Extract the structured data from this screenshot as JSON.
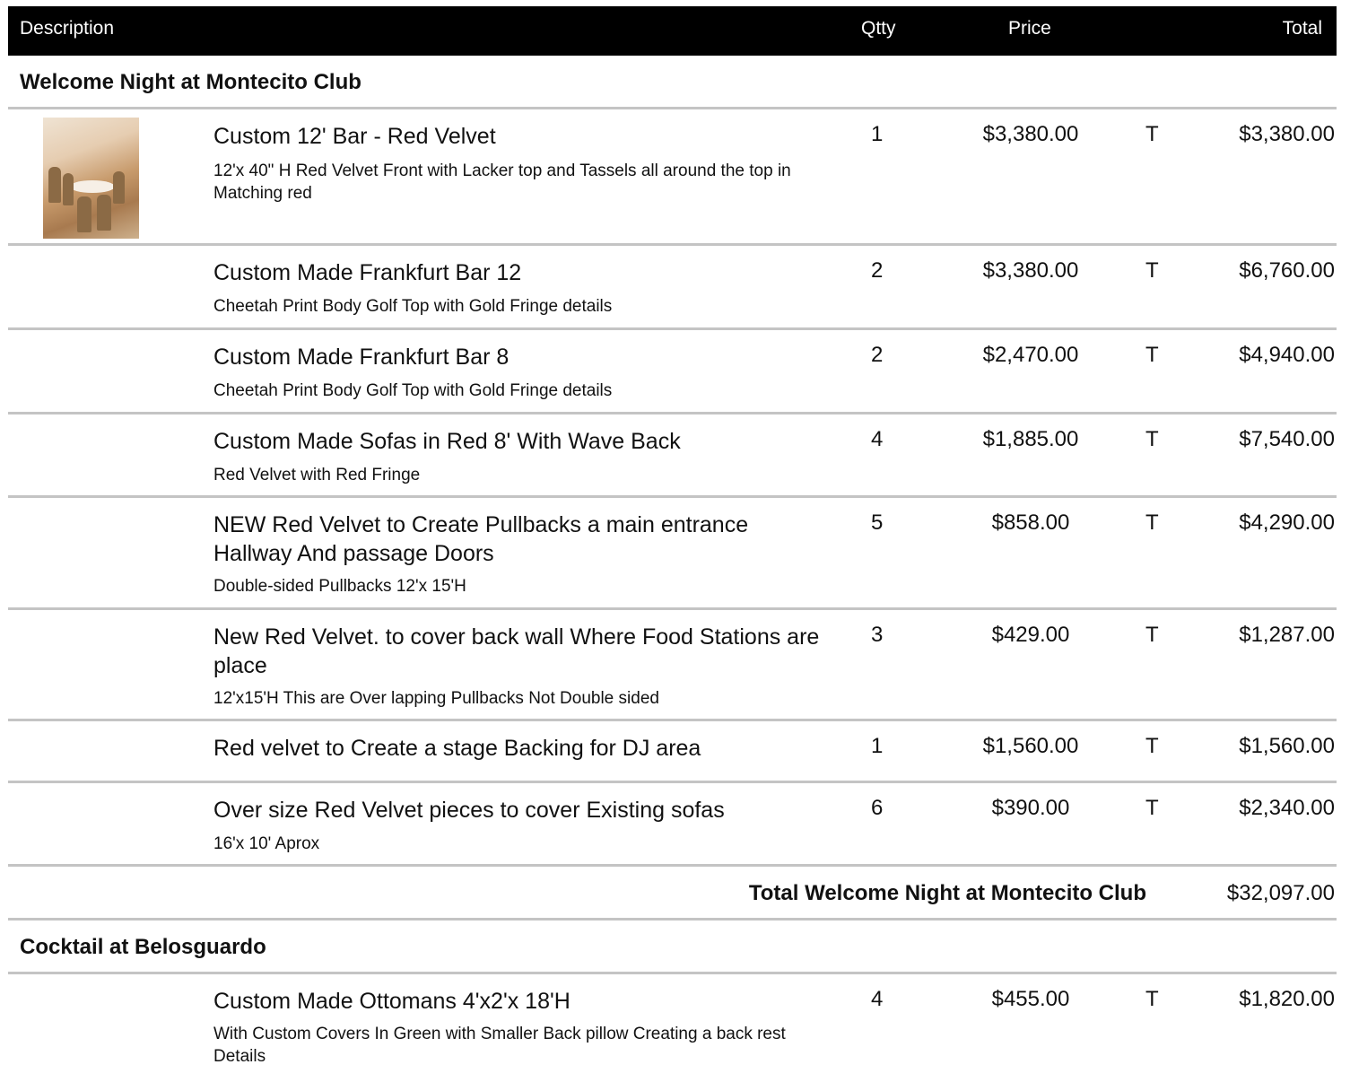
{
  "header": {
    "description": "Description",
    "qtty": "Qtty",
    "price": "Price",
    "total": "Total"
  },
  "sections": [
    {
      "title": "Welcome Night at Montecito Club",
      "items": [
        {
          "name": "Custom 12' Bar - Red Velvet",
          "desc": "12'x 40\" H Red Velvet Front with Lacker top and Tassels all around the top in Matching red",
          "qty": "1",
          "price": "$3,380.00",
          "tax": "T",
          "total": "$3,380.00"
        },
        {
          "name": "Custom Made Frankfurt Bar 12",
          "desc": "Cheetah Print Body   Golf Top with Gold Fringe details",
          "qty": "2",
          "price": "$3,380.00",
          "tax": "T",
          "total": "$6,760.00"
        },
        {
          "name": "Custom Made Frankfurt Bar 8",
          "desc": "Cheetah Print Body   Golf Top with Gold Fringe details",
          "qty": "2",
          "price": "$2,470.00",
          "tax": "T",
          "total": "$4,940.00"
        },
        {
          "name": "Custom Made Sofas in Red 8' With Wave Back",
          "desc": "Red Velvet with Red Fringe",
          "qty": "4",
          "price": "$1,885.00",
          "tax": "T",
          "total": "$7,540.00"
        },
        {
          "name": "NEW Red Velvet to Create Pullbacks a main entrance Hallway And passage Doors",
          "desc": "Double-sided Pullbacks 12'x 15'H",
          "qty": "5",
          "price": "$858.00",
          "tax": "T",
          "total": "$4,290.00"
        },
        {
          "name": "New Red Velvet. to cover back wall Where Food Stations are place",
          "desc": "12'x15'H This are Over lapping Pullbacks  Not Double sided",
          "qty": "3",
          "price": "$429.00",
          "tax": "T",
          "total": "$1,287.00"
        },
        {
          "name": "Red velvet to Create a stage Backing for DJ area",
          "desc": "",
          "qty": "1",
          "price": "$1,560.00",
          "tax": "T",
          "total": "$1,560.00"
        },
        {
          "name": "Over size  Red Velvet pieces to cover Existing sofas",
          "desc": "16'x 10' Aprox",
          "qty": "6",
          "price": "$390.00",
          "tax": "T",
          "total": "$2,340.00"
        }
      ],
      "subtotal_label": "Total Welcome Night at Montecito Club",
      "subtotal_value": "$32,097.00"
    },
    {
      "title": "Cocktail  at Belosguardo",
      "items": [
        {
          "name": "Custom Made Ottomans 4'x2'x 18'H",
          "desc": "With Custom Covers In Green with Smaller Back pillow Creating a back rest Details",
          "qty": "4",
          "price": "$455.00",
          "tax": "T",
          "total": "$1,820.00"
        }
      ]
    }
  ]
}
